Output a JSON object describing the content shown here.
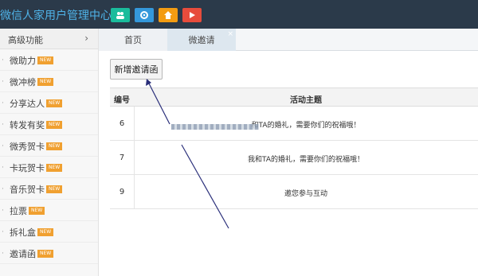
{
  "header": {
    "title": "微信人家用户管理中心",
    "buttons": [
      {
        "icon": "users-icon",
        "color": "#1abc9c"
      },
      {
        "icon": "gear-icon",
        "color": "#3498db"
      },
      {
        "icon": "home-icon",
        "color": "#f39c12"
      },
      {
        "icon": "play-icon",
        "color": "#e74c3c"
      }
    ]
  },
  "sidebar": {
    "header": {
      "label": "高级功能",
      "chevron": "›"
    },
    "badge_text": "NEW",
    "badge_color": "#f0a030",
    "items": [
      {
        "label": "微助力"
      },
      {
        "label": "微冲榜"
      },
      {
        "label": "分享达人"
      },
      {
        "label": "转发有奖"
      },
      {
        "label": "微秀贺卡"
      },
      {
        "label": "卡玩贺卡"
      },
      {
        "label": "音乐贺卡"
      },
      {
        "label": "拉票"
      },
      {
        "label": "拆礼盒"
      },
      {
        "label": "邀请函"
      }
    ]
  },
  "tabs": [
    {
      "label": "首页"
    },
    {
      "label": "微邀请",
      "close": "×"
    }
  ],
  "toolbar": {
    "add_label": "新增邀请函"
  },
  "table": {
    "headers": [
      "编号",
      "活动主题"
    ],
    "rows": [
      {
        "id": "6",
        "subject": "和TA的婚礼，需要你们的祝福哦！"
      },
      {
        "id": "7",
        "subject": "我和TA的婚礼，需要你们的祝福哦！"
      },
      {
        "id": "9",
        "subject": "邀您参与互动"
      }
    ]
  }
}
